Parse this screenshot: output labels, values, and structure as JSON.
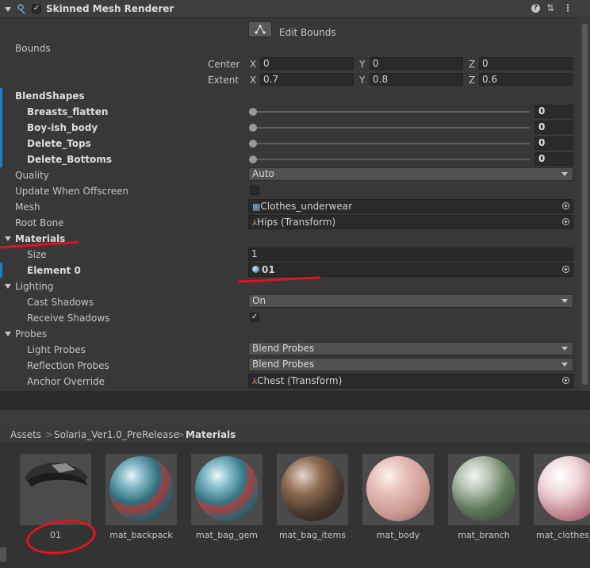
{
  "header": {
    "title": "Skinned Mesh Renderer",
    "help_icon": "?",
    "settings_icon": "⇅",
    "menu_icon": "⋮"
  },
  "edit_bounds": {
    "label": "Edit Bounds"
  },
  "bounds": {
    "label": "Bounds",
    "center_label": "Center",
    "extent_label": "Extent",
    "center": {
      "x": "0",
      "y": "0",
      "z": "0"
    },
    "extent": {
      "x": "0.7",
      "y": "0.8",
      "z": "0.6"
    },
    "axis_x": "X",
    "axis_y": "Y",
    "axis_z": "Z"
  },
  "blendshapes": {
    "label": "BlendShapes",
    "items": [
      {
        "name": "Breasts_flatten",
        "value": "0"
      },
      {
        "name": "Boy-ish_body",
        "value": "0"
      },
      {
        "name": "Delete_Tops",
        "value": "0"
      },
      {
        "name": "Delete_Bottoms",
        "value": "0"
      }
    ]
  },
  "quality": {
    "label": "Quality",
    "value": "Auto"
  },
  "update_offscreen": {
    "label": "Update When Offscreen"
  },
  "mesh": {
    "label": "Mesh",
    "value": "Clothes_underwear"
  },
  "root_bone": {
    "label": "Root Bone",
    "value": "Hips (Transform)"
  },
  "materials": {
    "label": "Materials",
    "size_label": "Size",
    "size_value": "1",
    "element_label": "Element 0",
    "element_value": "01"
  },
  "lighting": {
    "label": "Lighting",
    "cast_shadows_label": "Cast Shadows",
    "cast_shadows_value": "On",
    "receive_shadows_label": "Receive Shadows"
  },
  "probes": {
    "label": "Probes",
    "light_probes_label": "Light Probes",
    "light_probes_value": "Blend Probes",
    "reflection_probes_label": "Reflection Probes",
    "reflection_probes_value": "Blend Probes",
    "anchor_override_label": "Anchor Override",
    "anchor_override_value": "Chest (Transform)"
  },
  "breadcrumb": {
    "items": [
      "Assets",
      "Solaria_Ver1.0_PreRelease",
      "Materials"
    ],
    "separator": ">"
  },
  "assets": [
    {
      "name": "01"
    },
    {
      "name": "mat_backpack"
    },
    {
      "name": "mat_bag_gem"
    },
    {
      "name": "mat_bag_items"
    },
    {
      "name": "mat_body"
    },
    {
      "name": "mat_branch"
    },
    {
      "name": "mat_clothes_i"
    }
  ],
  "colors": {
    "background": "#383838",
    "field": "#2a2a2a",
    "accent": "#1a7dc6",
    "annotation": "#e0141e"
  }
}
